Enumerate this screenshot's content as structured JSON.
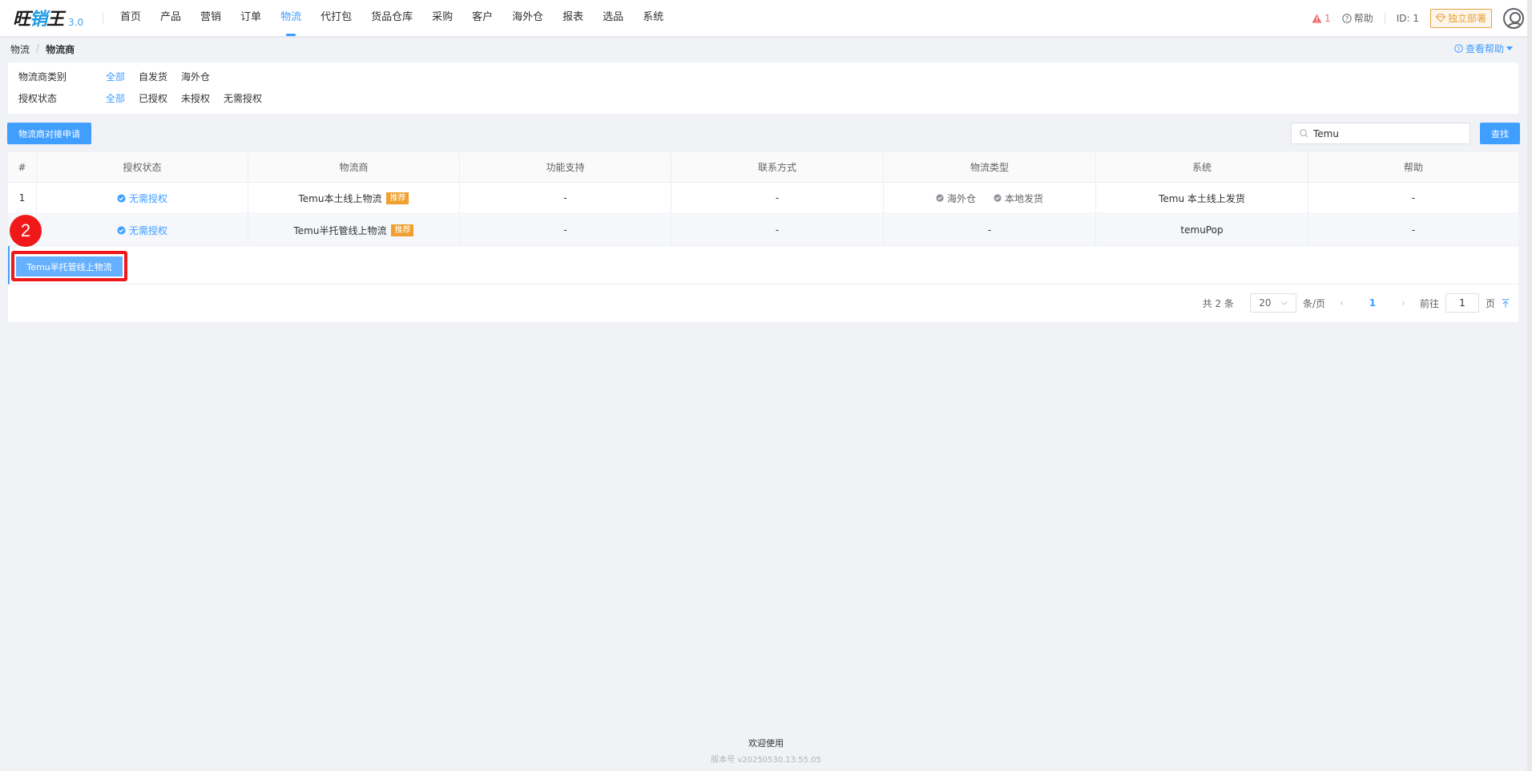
{
  "app": {
    "logo_main": "旺",
    "logo_mid": "销",
    "logo_end": "王",
    "version": "3.0"
  },
  "nav": [
    {
      "label": "首页"
    },
    {
      "label": "产品"
    },
    {
      "label": "营销"
    },
    {
      "label": "订单"
    },
    {
      "label": "物流",
      "active": true
    },
    {
      "label": "代打包"
    },
    {
      "label": "货品仓库"
    },
    {
      "label": "采购"
    },
    {
      "label": "客户"
    },
    {
      "label": "海外仓"
    },
    {
      "label": "报表"
    },
    {
      "label": "选品"
    },
    {
      "label": "系统"
    }
  ],
  "topright": {
    "alert_count": "1",
    "help_label": "帮助",
    "user_id": "ID: 1",
    "deploy_label": "独立部署"
  },
  "breadcrumb": {
    "parent": "物流",
    "sep": "/",
    "current": "物流商"
  },
  "page_help": "查看帮助",
  "filters": {
    "category": {
      "label": "物流商类别",
      "options": [
        "全部",
        "自发货",
        "海外仓"
      ]
    },
    "auth": {
      "label": "授权状态",
      "options": [
        "全部",
        "已授权",
        "未授权",
        "无需授权"
      ]
    }
  },
  "toolbar": {
    "apply_label": "物流商对接申请",
    "search_value": "Temu",
    "search_button": "查找"
  },
  "table": {
    "columns": [
      "#",
      "授权状态",
      "物流商",
      "功能支持",
      "联系方式",
      "物流类型",
      "系统",
      "帮助"
    ],
    "rows": [
      {
        "index": "1",
        "auth": "无需授权",
        "provider": "Temu本土线上物流",
        "tag": "推荐",
        "feature": "-",
        "contact": "-",
        "types": [
          "海外仓",
          "本地发货"
        ],
        "system": "Temu 本土线上发货",
        "help": "-"
      },
      {
        "index": "2",
        "auth": "无需授权",
        "provider": "Temu半托管线上物流",
        "tag": "推荐",
        "feature": "-",
        "contact": "-",
        "types_text": "-",
        "system": "temuPop",
        "help": "-"
      }
    ],
    "expand_button": "Temu半托管线上物流"
  },
  "overlay": {
    "step_number": "2",
    "highlight_color": "#f01818"
  },
  "pagination": {
    "total": "共 2 条",
    "page_size": "20",
    "per_page": "条/页",
    "current_page": "1",
    "goto_label": "前往",
    "goto_value": "1",
    "page_unit": "页"
  },
  "footer": {
    "welcome": "欢迎使用",
    "version": "版本号 v20250530.13.55.05"
  },
  "colors": {
    "accent": "#409eff",
    "warning": "#e6a23c",
    "tag": "#f0a030",
    "danger": "#f56c6c"
  }
}
